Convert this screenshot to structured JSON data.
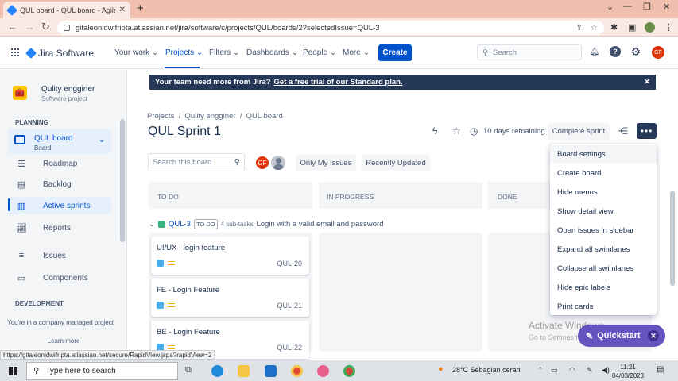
{
  "browser": {
    "tab_title": "QUL board - QUL board - Agile F",
    "url": "gitaleonidwifripta.atlassian.net/jira/software/c/projects/QUL/boards/2?selectedIssue=QUL-3",
    "status_url": "https://gitaleonidwifripta.atlassian.net/secure/RapidView.jspa?rapidView=2"
  },
  "jira_nav": {
    "product": "Jira Software",
    "menus": [
      "Your work",
      "Projects",
      "Filters",
      "Dashboards",
      "People",
      "More"
    ],
    "create_label": "Create",
    "search_placeholder": "Search",
    "user_initials": "GF"
  },
  "sidebar": {
    "project_name": "Qulity engginer",
    "project_type": "Software project",
    "planning_header": "PLANNING",
    "board_name": "QUL board",
    "board_sub": "Board",
    "items": [
      {
        "label": "Roadmap",
        "icon": "roadmap-icon"
      },
      {
        "label": "Backlog",
        "icon": "backlog-icon"
      },
      {
        "label": "Active sprints",
        "icon": "active-sprints-icon"
      },
      {
        "label": "Reports",
        "icon": "reports-icon"
      },
      {
        "label": "Issues",
        "icon": "issues-icon"
      },
      {
        "label": "Components",
        "icon": "components-icon"
      }
    ],
    "development_header": "DEVELOPMENT",
    "footer_text": "You're in a company managed project",
    "learn_more": "Learn more"
  },
  "banner": {
    "text": "Your team need more from Jira?",
    "link": "Get a free trial of our Standard plan."
  },
  "board": {
    "breadcrumbs": [
      "Projects",
      "Qulity engginer",
      "QUL board"
    ],
    "title": "QUL Sprint 1",
    "days_remaining": "10 days remaining",
    "complete_label": "Complete sprint",
    "search_placeholder": "Search this board",
    "avatar_initials": "GF",
    "filters": [
      "Only My Issues",
      "Recently Updated"
    ],
    "columns": [
      "TO DO",
      "IN PROGRESS",
      "DONE"
    ],
    "swimlane": {
      "key": "QUL-3",
      "status": "TO DO",
      "subtasks": "4 sub-tasks",
      "summary": "Login with a valid email and password"
    },
    "cards": [
      {
        "title": "UI/UX - login feature",
        "key": "QUL-20"
      },
      {
        "title": "FE - Login Feature",
        "key": "QUL-21"
      },
      {
        "title": "BE - Login Feature",
        "key": "QUL-22"
      }
    ]
  },
  "dropdown": {
    "items": [
      "Board settings",
      "Create board",
      "Hide menus",
      "Show detail view",
      "Open issues in sidebar",
      "Expand all swimlanes",
      "Collapse all swimlanes",
      "Hide epic labels",
      "Print cards"
    ]
  },
  "overlay": {
    "watermark_title": "Activate Windows",
    "watermark_sub": "Go to Settings to activate Windows.",
    "quickstart": "Quickstart"
  },
  "taskbar": {
    "search_placeholder": "Type here to search",
    "weather": "28°C  Sebagian cerah",
    "time": "11:21",
    "date": "04/03/2023"
  }
}
